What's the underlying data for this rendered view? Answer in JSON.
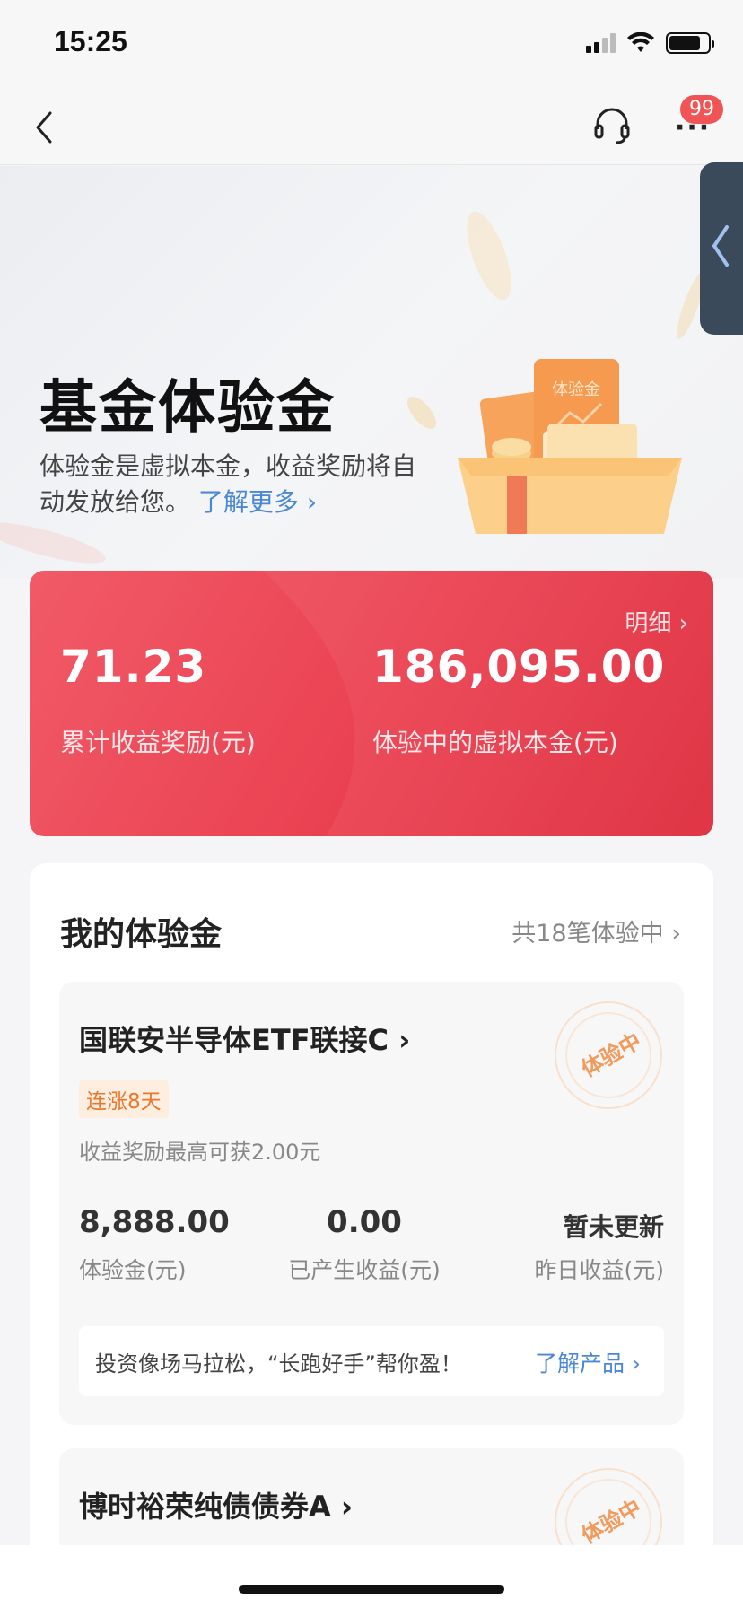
{
  "status": {
    "time": "15:25"
  },
  "nav": {
    "badge": "99",
    "more": "···"
  },
  "hero": {
    "title": "基金体验金",
    "description": "体验金是虚拟本金，收益奖励将自动发放给您。",
    "learn_more": "了解更多 ›",
    "illustration_label": "体验金"
  },
  "summary": {
    "detail_link": "明细 ›",
    "total_reward_value": "71.23",
    "total_reward_label": "累计收益奖励(元)",
    "virtual_principal_value": "186,095.00",
    "virtual_principal_label": "体验中的虚拟本金(元)"
  },
  "section": {
    "title": "我的体验金",
    "count": "共18笔体验中 ›"
  },
  "funds": [
    {
      "name": "国联安半导体ETF联接C ›",
      "tag": "连涨8天",
      "note": "收益奖励最高可获2.00元",
      "stamp": "体验中",
      "trial_amount": "8,888.00",
      "trial_amount_label": "体验金(元)",
      "earned": "0.00",
      "earned_label": "已产生收益(元)",
      "yesterday": "暂未更新",
      "yesterday_label": "昨日收益(元)",
      "banner_msg": "投资像场马拉松，“长跑好手”帮你盈！",
      "banner_link": "了解产品 ›"
    },
    {
      "name": "博时裕荣纯债债券A ›",
      "stamp": "体验中"
    }
  ],
  "colors": {
    "accent_red": "#ea4050",
    "link_blue": "#4a88d6",
    "tag_orange": "#e8782d"
  }
}
